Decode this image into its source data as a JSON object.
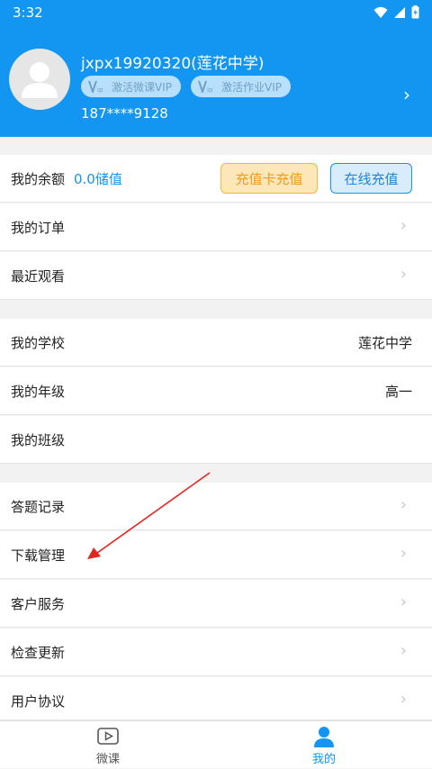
{
  "status": {
    "time": "3:32"
  },
  "profile": {
    "username": "jxpx19920320(莲花中学)",
    "vip_weike": "激活微课VIP",
    "vip_homework": "激活作业VIP",
    "phone": "187****9128"
  },
  "balance": {
    "label": "我的余额",
    "value": "0.0储值",
    "card_button": "充值卡充值",
    "online_button": "在线充值"
  },
  "menu1": [
    {
      "label": "我的订单"
    },
    {
      "label": "最近观看"
    }
  ],
  "school": {
    "school_label": "我的学校",
    "school_value": "莲花中学",
    "grade_label": "我的年级",
    "grade_value": "高一",
    "class_label": "我的班级"
  },
  "menu2": [
    {
      "label": "答题记录"
    },
    {
      "label": "下载管理"
    },
    {
      "label": "客户服务"
    },
    {
      "label": "检查更新"
    },
    {
      "label": "用户协议"
    }
  ],
  "tabs": [
    {
      "label": "微课"
    },
    {
      "label": "我的"
    }
  ],
  "colors": {
    "primary": "#1296f2",
    "card_button": "#f19c17",
    "annotation_arrow": "#e8231e"
  },
  "icons": [
    "wifi-icon",
    "signal-icon",
    "battery-icon",
    "avatar-icon",
    "vip-icon",
    "chevron-right-icon",
    "video-play-icon",
    "person-icon"
  ]
}
